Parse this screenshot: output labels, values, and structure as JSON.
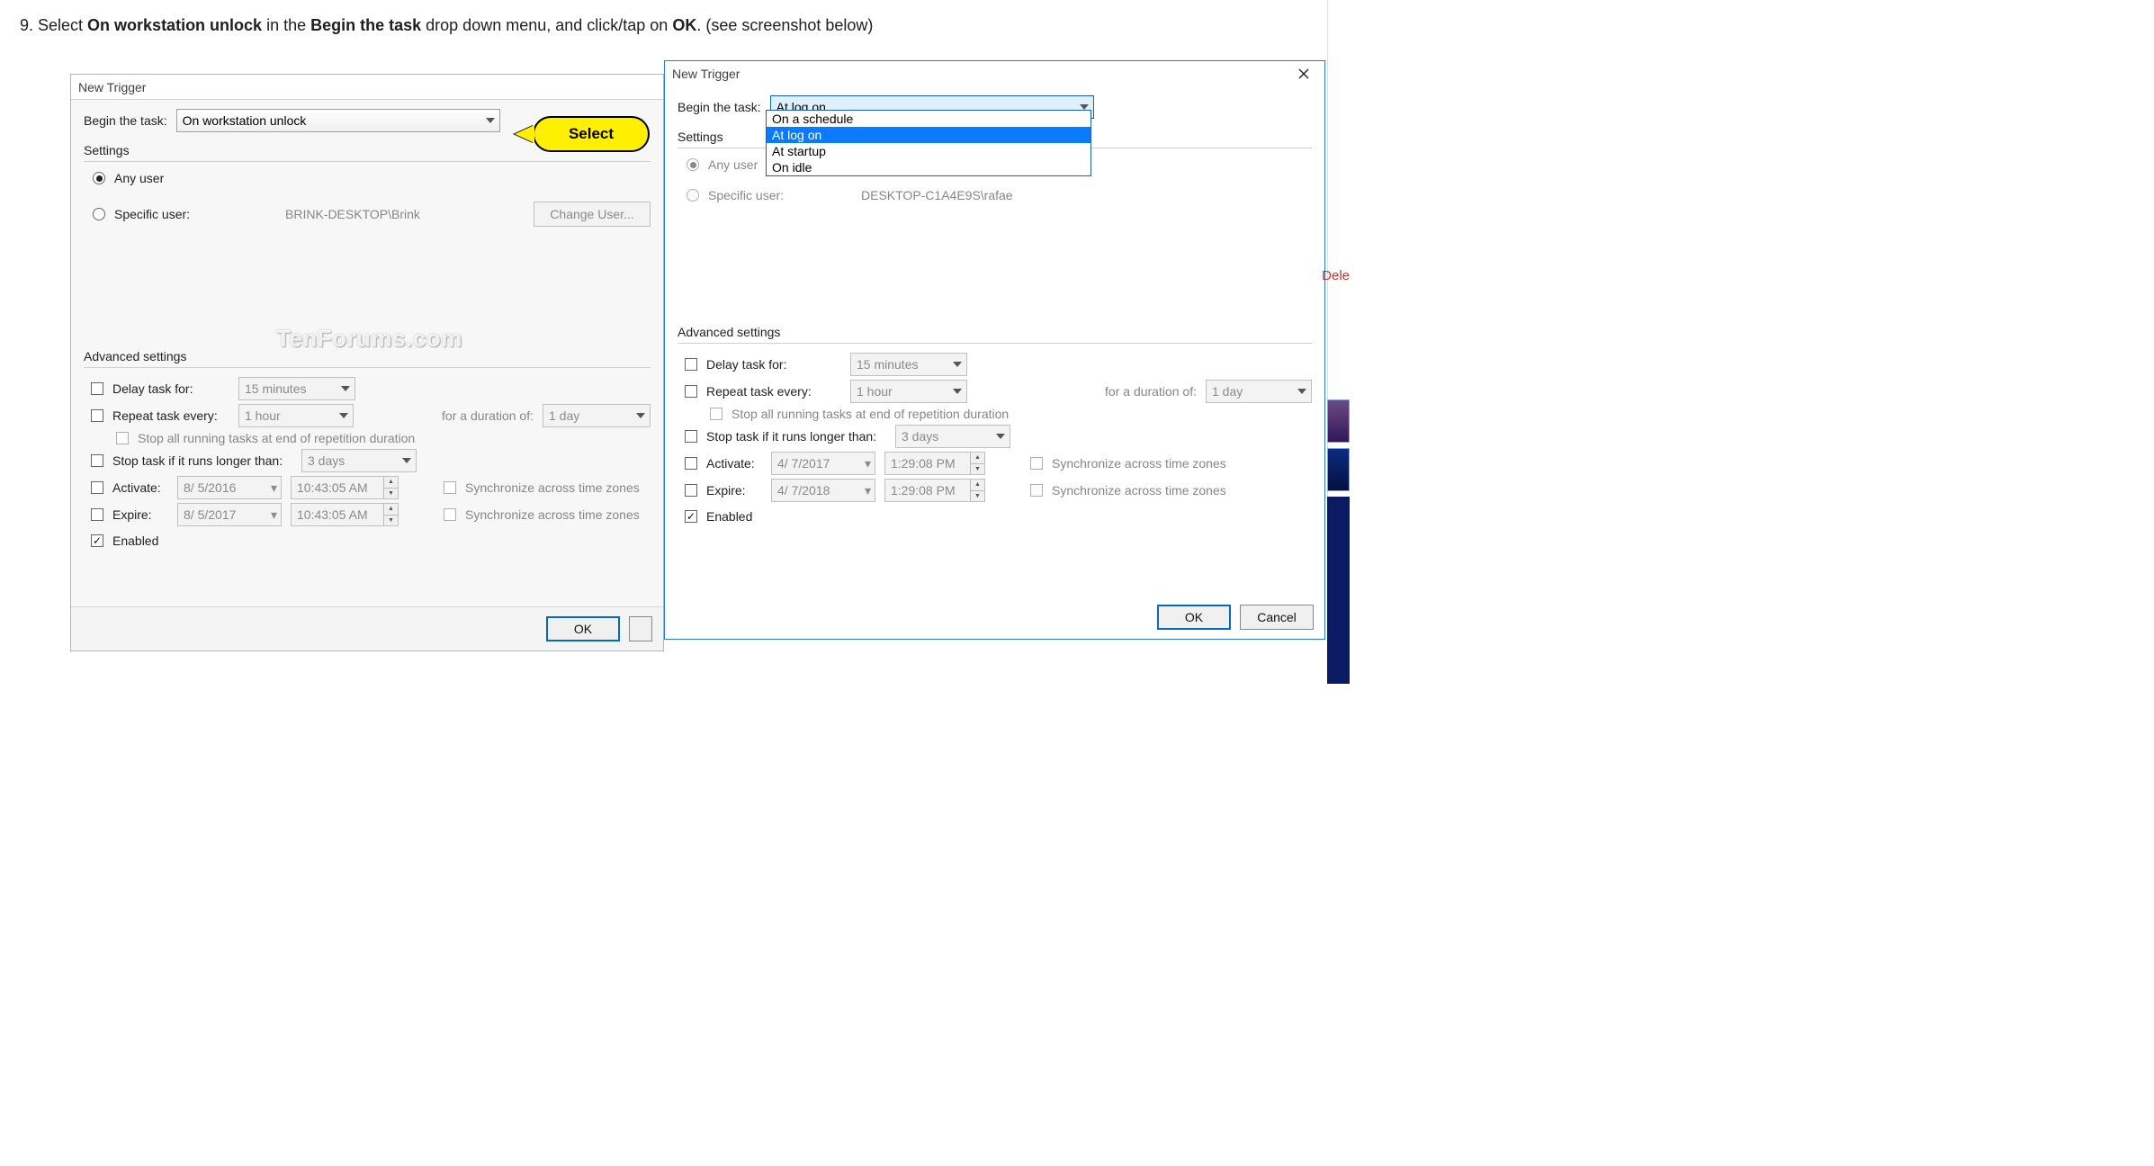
{
  "instruction": {
    "prefix": "9. Select ",
    "bold1": "On workstation unlock",
    "mid1": " in the ",
    "bold2": "Begin the task",
    "mid2": " drop down menu, and click/tap on ",
    "bold3": "OK",
    "suffix": ". (see screenshot below)"
  },
  "bubble_label": "Select",
  "watermark": "TenForums.com",
  "left_window": {
    "title": "New Trigger",
    "begin_label": "Begin the task:",
    "begin_value": "On workstation unlock",
    "settings_group": "Settings",
    "any_user": "Any user",
    "specific_user": "Specific user:",
    "specific_user_value": "BRINK-DESKTOP\\Brink",
    "change_user_btn": "Change User...",
    "advanced_group": "Advanced settings",
    "delay_label": "Delay task for:",
    "delay_value": "15 minutes",
    "repeat_label": "Repeat task every:",
    "repeat_value": "1 hour",
    "duration_label": "for a duration of:",
    "duration_value": "1 day",
    "stop_all_label": "Stop all running tasks at end of repetition duration",
    "stop_long_label": "Stop task if it runs longer than:",
    "stop_long_value": "3 days",
    "activate_label": "Activate:",
    "activate_date": "8/ 5/2016",
    "activate_time": "10:43:05 AM",
    "expire_label": "Expire:",
    "expire_date": "8/ 5/2017",
    "expire_time": "10:43:05 AM",
    "sync_label": "Synchronize across time zones",
    "enabled_label": "Enabled",
    "ok_btn": "OK"
  },
  "right_window": {
    "title": "New Trigger",
    "begin_label": "Begin the task:",
    "begin_value": "At log on",
    "dd_options": [
      "On a schedule",
      "At log on",
      "At startup",
      "On idle"
    ],
    "dd_selected_index": 1,
    "settings_group": "Settings",
    "any_user": "Any user",
    "specific_user": "Specific user:",
    "specific_user_value": "DESKTOP-C1A4E9S\\rafae",
    "advanced_group": "Advanced settings",
    "delay_label": "Delay task for:",
    "delay_value": "15 minutes",
    "repeat_label": "Repeat task every:",
    "repeat_value": "1 hour",
    "duration_label": "for a duration of:",
    "duration_value": "1 day",
    "stop_all_label": "Stop all running tasks at end of repetition duration",
    "stop_long_label": "Stop task if it runs longer than:",
    "stop_long_value": "3 days",
    "activate_label": "Activate:",
    "activate_date": "4/ 7/2017",
    "activate_time": "1:29:08 PM",
    "expire_label": "Expire:",
    "expire_date": "4/ 7/2018",
    "expire_time": "1:29:08 PM",
    "sync_label": "Synchronize across time zones",
    "enabled_label": "Enabled",
    "ok_btn": "OK",
    "cancel_btn": "Cancel"
  },
  "peek": {
    "delete_text": "Dele"
  }
}
